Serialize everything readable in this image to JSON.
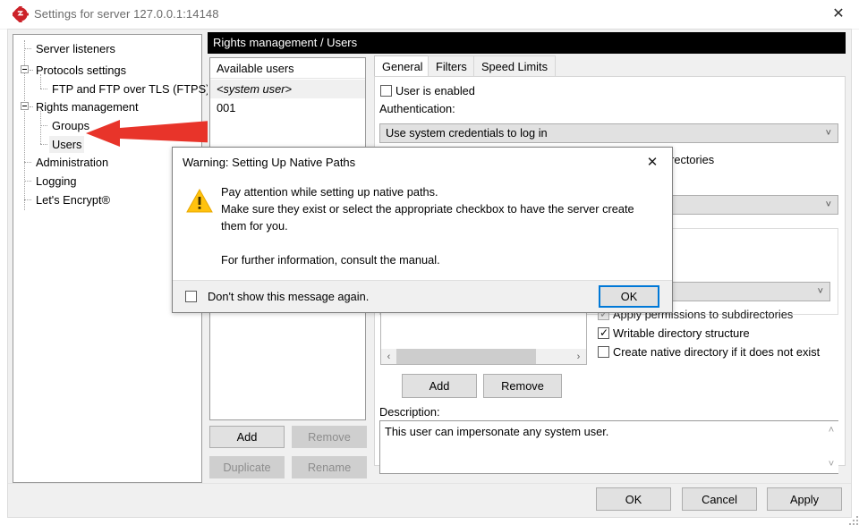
{
  "window": {
    "title": "Settings for server 127.0.0.1:14148",
    "icon": "filezilla-server-icon",
    "close_label": "✕"
  },
  "tree": {
    "items": [
      {
        "label": "Server listeners"
      },
      {
        "label": "Protocols settings"
      },
      {
        "label": "FTP and FTP over TLS (FTPS)"
      },
      {
        "label": "Rights management"
      },
      {
        "label": "Groups"
      },
      {
        "label": "Users"
      },
      {
        "label": "Administration"
      },
      {
        "label": "Logging"
      },
      {
        "label": "Let's Encrypt®"
      }
    ],
    "selected": "Users"
  },
  "annotation": {
    "arrow_color": "#e8342a"
  },
  "content": {
    "header": "Rights management / Users",
    "users_panel": {
      "header": "Available users",
      "items": [
        {
          "label": "<system user>",
          "selected": true
        },
        {
          "label": "001",
          "selected": false
        }
      ],
      "buttons": [
        {
          "label": "Add",
          "enabled": true
        },
        {
          "label": "Remove",
          "enabled": false
        },
        {
          "label": "Duplicate",
          "enabled": false
        },
        {
          "label": "Rename",
          "enabled": false
        }
      ]
    },
    "tabs": [
      {
        "label": "General",
        "active": true
      },
      {
        "label": "Filters",
        "active": false
      },
      {
        "label": "Speed Limits",
        "active": false
      }
    ],
    "general": {
      "user_enabled_label": "User is enabled",
      "user_enabled_checked": false,
      "authentication_label": "Authentication:",
      "authentication_value": "Use system credentials to log in",
      "mount_label": "Mount directories",
      "mount_combo_value": "",
      "permissions_combo_value": "",
      "access_combo_value": "",
      "checkboxes": [
        {
          "label": "Apply permissions to subdirectories",
          "checked": true,
          "disabled": true
        },
        {
          "label": "Writable directory structure",
          "checked": true,
          "disabled": false
        },
        {
          "label": "Create native directory if it does not exist",
          "checked": false,
          "disabled": false
        }
      ],
      "list_buttons": [
        {
          "label": "Add"
        },
        {
          "label": "Remove"
        }
      ],
      "description_label": "Description:",
      "description_value": "This user can impersonate any system user.",
      "scroll_left": "‹",
      "scroll_right": "›",
      "scroll_up": "˄",
      "scroll_down": "˅",
      "chevron": "˅"
    }
  },
  "footer": {
    "buttons": [
      {
        "label": "OK"
      },
      {
        "label": "Cancel"
      },
      {
        "label": "Apply"
      }
    ]
  },
  "dialog": {
    "title": "Warning: Setting Up Native Paths",
    "close_label": "✕",
    "icon": "warning-triangle-icon",
    "message": "Pay attention while setting up native paths.\nMake sure they exist or select the appropriate checkbox to have the server create\nthem for you.\n\nFor further information, consult the manual.",
    "dont_show_label": "Don't show this message again.",
    "dont_show_checked": false,
    "ok_label": "OK"
  }
}
